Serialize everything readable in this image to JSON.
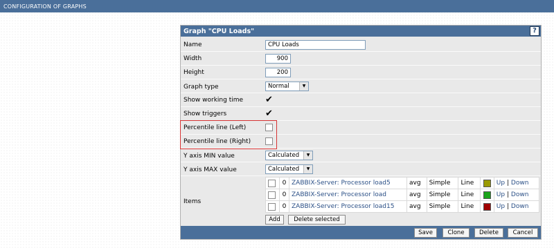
{
  "page": {
    "header": "CONFIGURATION OF GRAPHS"
  },
  "panel": {
    "title": "Graph \"CPU Loads\"",
    "help_label": "?"
  },
  "form": {
    "name": {
      "label": "Name",
      "value": "CPU Loads"
    },
    "width": {
      "label": "Width",
      "value": "900"
    },
    "height": {
      "label": "Height",
      "value": "200"
    },
    "graph_type": {
      "label": "Graph type",
      "value": "Normal"
    },
    "show_working_time": {
      "label": "Show working time",
      "checked": true,
      "mark": "✔"
    },
    "show_triggers": {
      "label": "Show triggers",
      "checked": true,
      "mark": "✔"
    },
    "percentile_left": {
      "label": "Percentile line (Left)",
      "checked": false
    },
    "percentile_right": {
      "label": "Percentile line (Right)",
      "checked": false
    },
    "y_min": {
      "label": "Y axis MIN value",
      "value": "Calculated"
    },
    "y_max": {
      "label": "Y axis MAX value",
      "value": "Calculated"
    },
    "items_label": "Items"
  },
  "items": [
    {
      "order": "0",
      "name": "ZABBIX-Server: Processor load5",
      "func": "avg",
      "drawtype": "Simple",
      "style": "Line",
      "color": "#9a9a00",
      "up": "Up",
      "sep": "|",
      "down": "Down"
    },
    {
      "order": "0",
      "name": "ZABBIX-Server: Processor load",
      "func": "avg",
      "drawtype": "Simple",
      "style": "Line",
      "color": "#1aa31a",
      "up": "Up",
      "sep": "|",
      "down": "Down"
    },
    {
      "order": "0",
      "name": "ZABBIX-Server: Processor load15",
      "func": "avg",
      "drawtype": "Simple",
      "style": "Line",
      "color": "#a00000",
      "up": "Up",
      "sep": "|",
      "down": "Down"
    }
  ],
  "item_buttons": {
    "add": "Add",
    "delete_selected": "Delete selected"
  },
  "footer_buttons": {
    "save": "Save",
    "clone": "Clone",
    "delete": "Delete",
    "cancel": "Cancel"
  },
  "colors": {
    "header_bar": "#4a6f9a",
    "highlight_box": "#d63333"
  }
}
